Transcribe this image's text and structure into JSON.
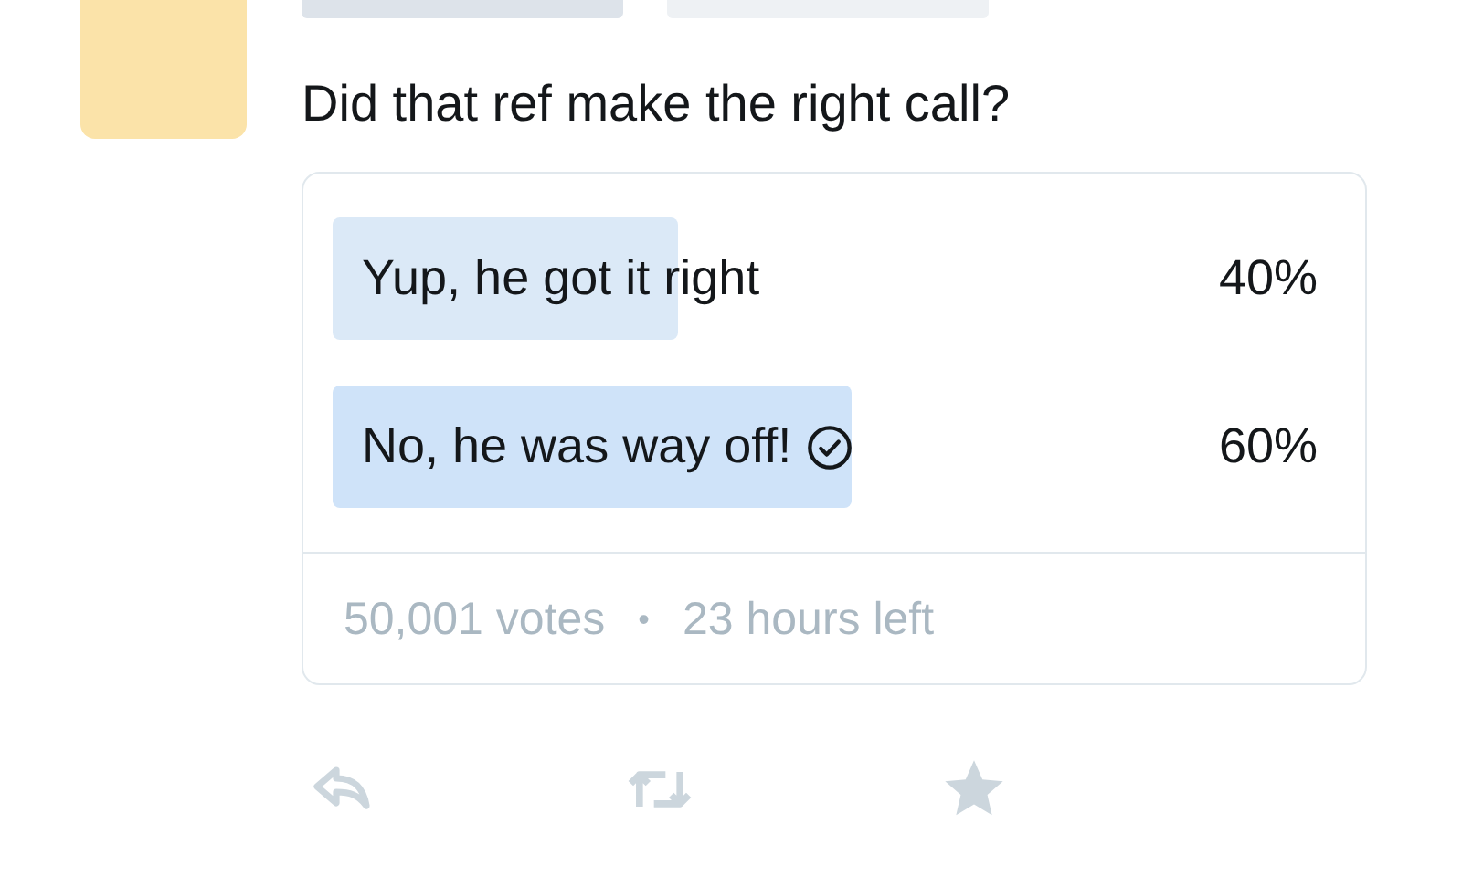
{
  "question": "Did that ref make the right call?",
  "options": [
    {
      "label": "Yup, he got it right",
      "percent": "40%",
      "selected": false
    },
    {
      "label": "No, he was way off!",
      "percent": "60%",
      "selected": true
    }
  ],
  "footer": {
    "votes": "50,001 votes",
    "separator": "•",
    "time_left": "23 hours left"
  }
}
